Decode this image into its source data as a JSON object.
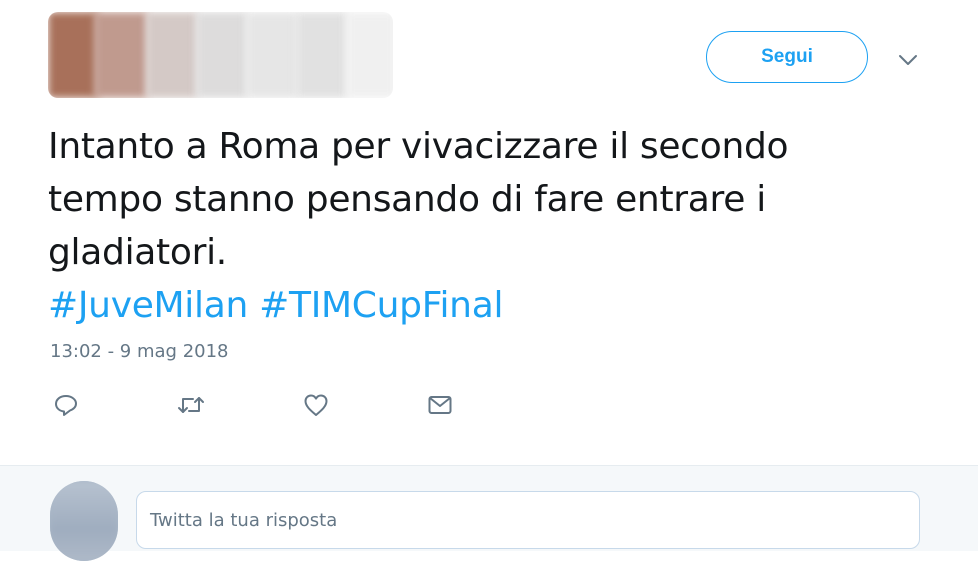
{
  "header": {
    "follow_label": "Segui",
    "more_icon": "chevron-down-icon"
  },
  "tweet": {
    "text_lines": [
      "Intanto a Roma per vivacizzare il secondo",
      "tempo stanno pensando di fare entrare i",
      "gladiatori."
    ],
    "hashtags": [
      "#JuveMilan",
      "#TIMCupFinal"
    ],
    "timestamp": "13:02 - 9 mag 2018"
  },
  "actions": [
    {
      "icon": "reply-icon"
    },
    {
      "icon": "retweet-icon"
    },
    {
      "icon": "heart-icon"
    },
    {
      "icon": "direct-message-icon"
    }
  ],
  "reply": {
    "placeholder": "Twitta la tua risposta"
  },
  "colors": {
    "accent": "#1da1f2",
    "text": "#14171a",
    "muted": "#657786",
    "reply_bg": "#f5f8fa"
  }
}
